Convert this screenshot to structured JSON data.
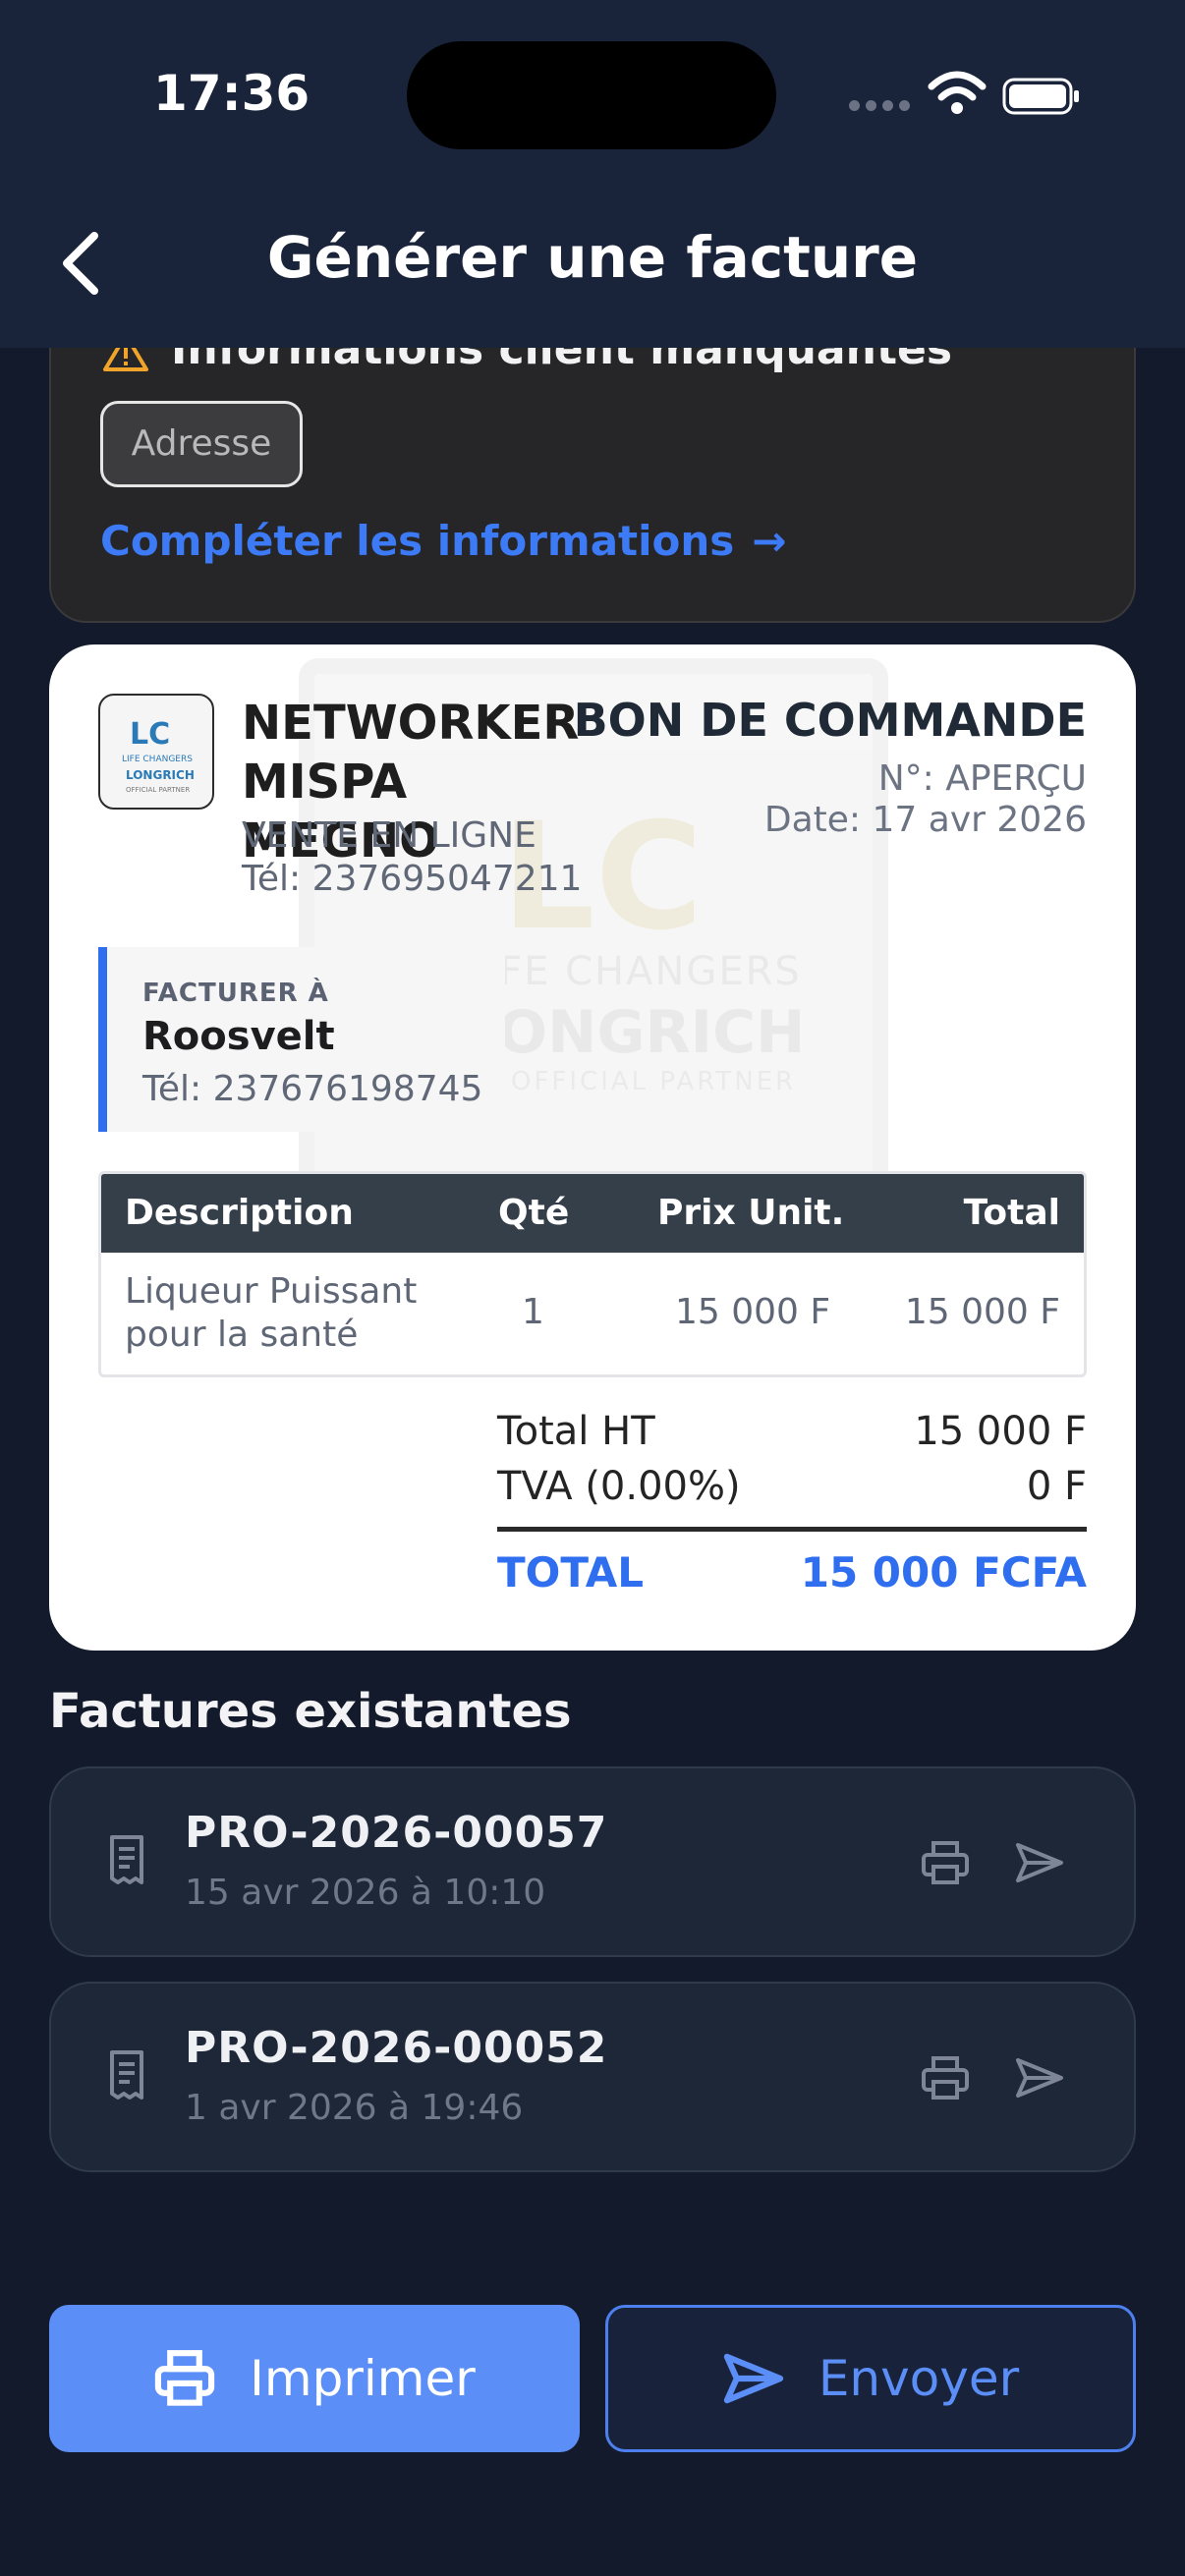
{
  "status_bar": {
    "time": "17:36"
  },
  "header": {
    "title": "Générer une facture"
  },
  "warning": {
    "title": "Informations client manquantes",
    "chips": [
      "Adresse"
    ],
    "action_label": "Compléter les informations",
    "action_arrow": "→",
    "icon_color": "#f0a52a"
  },
  "invoice": {
    "logo_text": {
      "initials": "LC",
      "line1": "LIFE CHANGERS",
      "line2": "LONGRICH",
      "line3": "OFFICIAL PARTNER"
    },
    "watermark": {
      "initials": "LC",
      "line1": "LIFE CHANGERS",
      "line2": "LONGRICH",
      "line3": "OFFICIAL PARTNER"
    },
    "seller": {
      "name": "NETWORKER MISPA MEGNO",
      "subtitle": "VENTE EN LIGNE",
      "phone": "Tél: 237695047211"
    },
    "document": {
      "title": "BON DE COMMANDE",
      "number": "N°: APERÇU",
      "date": "Date: 17 avr 2026"
    },
    "bill_to": {
      "label": "FACTURER À",
      "name": "Roosvelt",
      "phone": "Tél: 237676198745"
    },
    "table": {
      "headers": {
        "description": "Description",
        "qty": "Qté",
        "unit_price": "Prix Unit.",
        "total": "Total"
      },
      "rows": [
        {
          "description": "Liqueur Puissant pour la santé",
          "qty": "1",
          "unit_price": "15 000 F",
          "total": "15 000 F"
        }
      ]
    },
    "totals": {
      "subtotal_label": "Total HT",
      "subtotal_value": "15 000 F",
      "tax_label": "TVA (0.00%)",
      "tax_value": "0 F",
      "grand_label": "TOTAL",
      "grand_value": "15 000 FCFA"
    },
    "accent_color": "#2f6fef"
  },
  "existing": {
    "title": "Factures existantes",
    "items": [
      {
        "number": "PRO-2026-00057",
        "date": "15 avr 2026 à 10:10"
      },
      {
        "number": "PRO-2026-00052",
        "date": "1 avr 2026 à 19:46"
      }
    ]
  },
  "actions": {
    "print_label": "Imprimer",
    "send_label": "Envoyer",
    "primary_color": "#5b8ef7"
  },
  "icons": {
    "back": "chevron-left-icon",
    "warning": "warning-triangle-icon",
    "document": "receipt-icon",
    "print": "printer-icon",
    "send": "paper-plane-icon"
  }
}
